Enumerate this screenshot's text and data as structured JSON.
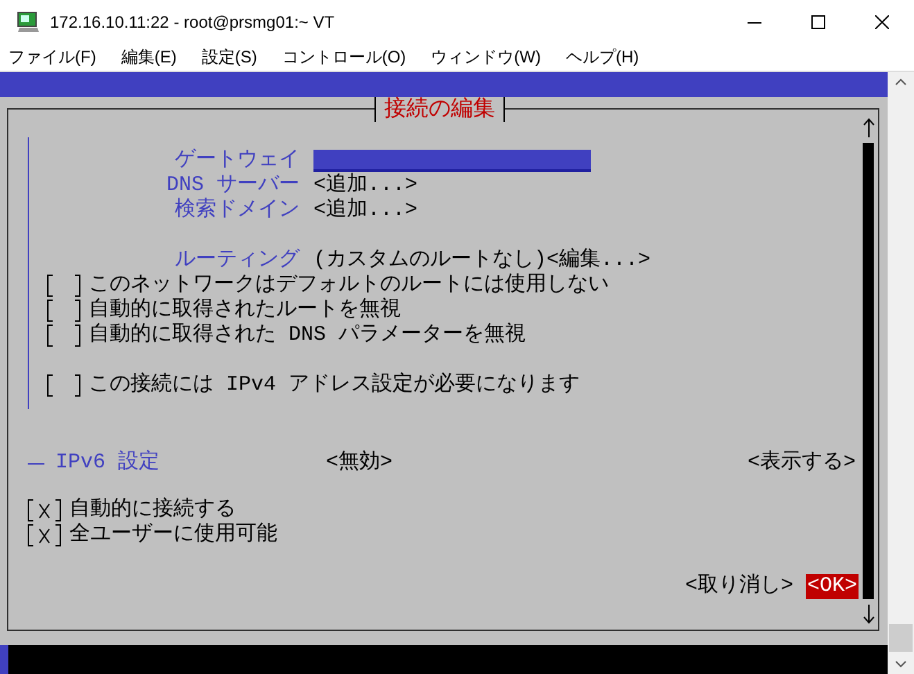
{
  "window": {
    "title": "172.16.10.11:22 - root@prsmg01:~ VT"
  },
  "menu": [
    {
      "label": "ファイル(F)"
    },
    {
      "label": "編集(E)"
    },
    {
      "label": "設定(S)"
    },
    {
      "label": "コントロール(O)"
    },
    {
      "label": "ウィンドウ(W)"
    },
    {
      "label": "ヘルプ(H)"
    }
  ],
  "dialog": {
    "title": "接続の編集",
    "ipv4_rows": [
      {
        "kind": "field",
        "label": "ゲートウェイ",
        "focused": true
      },
      {
        "kind": "action",
        "label": "DNS サーバー",
        "action": "<追加...>"
      },
      {
        "kind": "action",
        "label": "検索ドメイン",
        "action": "<追加...>"
      },
      {
        "kind": "gap"
      },
      {
        "kind": "routing",
        "label": "ルーティング",
        "value": "(カスタムのルートなし)",
        "action": "<編集...>"
      },
      {
        "kind": "checkbox",
        "label": "このネットワークはデフォルトのルートには使用しない",
        "checked": false
      },
      {
        "kind": "checkbox",
        "label": "自動的に取得されたルートを無視",
        "checked": false
      },
      {
        "kind": "checkbox",
        "label": "自動的に取得された DNS パラメーターを無視",
        "checked": false
      },
      {
        "kind": "gap"
      },
      {
        "kind": "checkbox",
        "label": "この接続には IPv4 アドレス設定が必要になります",
        "checked": false
      }
    ],
    "ipv6": {
      "label": "IPv6 設定",
      "mode": "<無効>",
      "action": "<表示する>",
      "expanded": false
    },
    "options": [
      {
        "label": "自動的に接続する",
        "checked": true
      },
      {
        "label": "全ユーザーに使用可能",
        "checked": true
      }
    ],
    "buttons": [
      {
        "label": "<取り消し>",
        "selected": false
      },
      {
        "label": "<OK>",
        "selected": true
      }
    ]
  }
}
